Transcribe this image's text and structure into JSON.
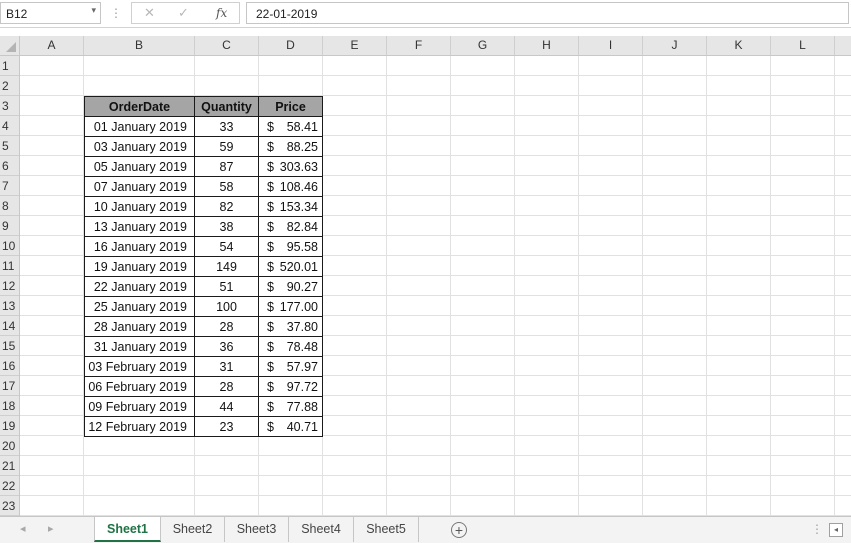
{
  "formula_bar": {
    "name_box": "B12",
    "name_box_arrow": "▾",
    "dots": "⋮",
    "cancel_icon": "✕",
    "enter_icon": "✓",
    "fx_label": "fx",
    "formula_value": "22-01-2019"
  },
  "column_headers": [
    "A",
    "B",
    "C",
    "D",
    "E",
    "F",
    "G",
    "H",
    "I",
    "J",
    "K",
    "L"
  ],
  "row_headers": [
    "1",
    "2",
    "3",
    "4",
    "5",
    "6",
    "7",
    "8",
    "9",
    "10",
    "11",
    "12",
    "13",
    "14",
    "15",
    "16",
    "17",
    "18",
    "19",
    "20",
    "21",
    "22",
    "23"
  ],
  "table": {
    "headers": [
      "OrderDate",
      "Quantity",
      "Price"
    ],
    "currency_symbol": "$",
    "rows": [
      [
        "01 January 2019",
        "33",
        "58.41"
      ],
      [
        "03 January 2019",
        "59",
        "88.25"
      ],
      [
        "05 January 2019",
        "87",
        "303.63"
      ],
      [
        "07 January 2019",
        "58",
        "108.46"
      ],
      [
        "10 January 2019",
        "82",
        "153.34"
      ],
      [
        "13 January 2019",
        "38",
        "82.84"
      ],
      [
        "16 January 2019",
        "54",
        "95.58"
      ],
      [
        "19 January 2019",
        "149",
        "520.01"
      ],
      [
        "22 January 2019",
        "51",
        "90.27"
      ],
      [
        "25 January 2019",
        "100",
        "177.00"
      ],
      [
        "28 January 2019",
        "28",
        "37.80"
      ],
      [
        "31 January 2019",
        "36",
        "78.48"
      ],
      [
        "03 February 2019",
        "31",
        "57.97"
      ],
      [
        "06 February 2019",
        "28",
        "97.72"
      ],
      [
        "09 February 2019",
        "44",
        "77.88"
      ],
      [
        "12 February 2019",
        "23",
        "40.71"
      ]
    ]
  },
  "sheet_tabs": {
    "tabs": [
      "Sheet1",
      "Sheet2",
      "Sheet3",
      "Sheet4",
      "Sheet5"
    ],
    "active_index": 0,
    "add_icon": "+",
    "prev_icon": "◂",
    "next_icon": "▸"
  },
  "colors": {
    "header_fill": "#a5a5a5",
    "active_tab": "#217346",
    "gridline": "#e1e1e1"
  }
}
